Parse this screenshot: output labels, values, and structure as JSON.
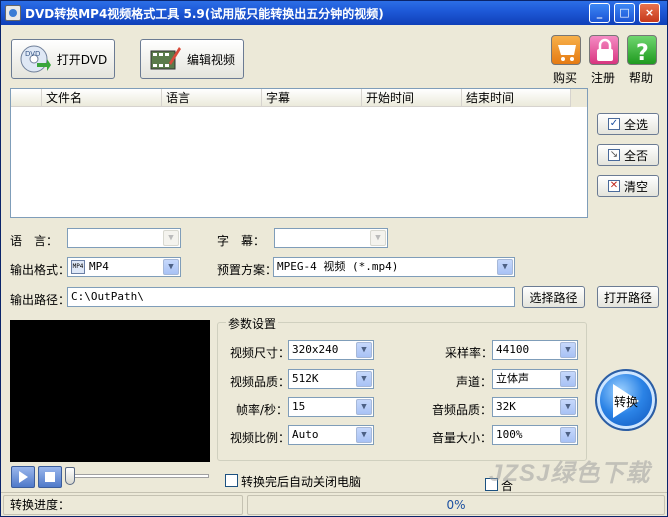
{
  "window": {
    "title": "DVD转换MP4视频格式工具 5.9(试用版只能转换出五分钟的视频)",
    "minimize": "_",
    "maximize": "□",
    "close": "×"
  },
  "toolbar": {
    "open_dvd": "打开DVD",
    "edit_video": "编辑视频",
    "buy": "购买",
    "register": "注册",
    "help": "帮助"
  },
  "file_list": {
    "columns": [
      "文件名",
      "语言",
      "字幕",
      "开始时间",
      "结束时间"
    ]
  },
  "side_buttons": {
    "select_all": "全选",
    "select_none": "全否",
    "clear": "清空"
  },
  "form": {
    "language_label": "语　言：",
    "language_value": "",
    "subtitle_label": "字　幕：",
    "subtitle_value": "",
    "output_format_label": "输出格式：",
    "output_format_value": "MP4",
    "preset_label": "预置方案：",
    "preset_value": "MPEG-4 视频 (*.mp4)",
    "output_path_label": "输出路径：",
    "output_path_value": "C:\\OutPath\\",
    "choose_path": "选择路径",
    "open_path": "打开路径"
  },
  "params": {
    "group_title": "参数设置",
    "video_size_label": "视频尺寸：",
    "video_size_value": "320x240",
    "video_quality_label": "视频品质：",
    "video_quality_value": "512K",
    "frame_rate_label": "帧率/秒：",
    "frame_rate_value": "15",
    "video_ratio_label": "视频比例：",
    "video_ratio_value": "Auto",
    "sample_rate_label": "采样率：",
    "sample_rate_value": "44100",
    "channel_label": "声道：",
    "channel_value": "立体声",
    "audio_quality_label": "音频品质：",
    "audio_quality_value": "32K",
    "volume_label": "音量大小：",
    "volume_value": "100%"
  },
  "playback": {
    "progress": 0
  },
  "options": {
    "auto_shutdown": "转换完后自动关闭电脑",
    "merge_short": "合"
  },
  "convert": {
    "label": "转换"
  },
  "status": {
    "progress_label": "转换进度：",
    "percent": "0%"
  },
  "watermark": {
    "text": "JZSJ绿色下载"
  },
  "colors": {
    "titlebar": "#1e5ad8",
    "window_bg": "#ece9d8",
    "accent_blue": "#2b83e6",
    "buy_orange": "#f08c1e",
    "register_pink": "#e84b9c",
    "help_green": "#2fae2f"
  }
}
